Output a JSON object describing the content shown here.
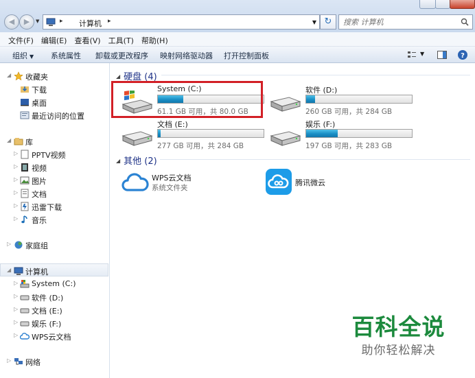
{
  "address": {
    "crumb": "计算机",
    "search_placeholder": "搜索 计算机"
  },
  "menu": [
    "文件(F)",
    "编辑(E)",
    "查看(V)",
    "工具(T)",
    "帮助(H)"
  ],
  "commands": {
    "organize": "组织",
    "properties": "系统属性",
    "uninstall": "卸载或更改程序",
    "map_drive": "映射网络驱动器",
    "control_panel": "打开控制面板"
  },
  "nav": {
    "favorites": "收藏夹",
    "downloads": "下载",
    "desktop": "桌面",
    "recent": "最近访问的位置",
    "libraries": "库",
    "pptv": "PPTV视频",
    "videos": "视频",
    "pictures": "图片",
    "documents": "文档",
    "thunder": "迅雷下载",
    "music": "音乐",
    "homegroup": "家庭组",
    "computer": "计算机",
    "drive_c": "System (C:)",
    "drive_d": "软件 (D:)",
    "drive_e": "文档 (E:)",
    "drive_f": "娱乐 (F:)",
    "wps": "WPS云文档",
    "network": "网络"
  },
  "groups": {
    "drives_header": "硬盘 (4)",
    "other_header": "其他 (2)"
  },
  "drives": [
    {
      "name": "System (C:)",
      "info": "61.1 GB 可用，共 80.0 GB",
      "used_fraction": 0.24
    },
    {
      "name": "软件 (D:)",
      "info": "260 GB 可用，共 284 GB",
      "used_fraction": 0.085
    },
    {
      "name": "文档 (E:)",
      "info": "277 GB 可用，共 284 GB",
      "used_fraction": 0.025
    },
    {
      "name": "娱乐 (F:)",
      "info": "197 GB 可用，共 283 GB",
      "used_fraction": 0.3
    }
  ],
  "others": [
    {
      "name": "WPS云文档",
      "sub": "系统文件夹"
    },
    {
      "name": "腾讯微云",
      "sub": ""
    }
  ],
  "watermark": {
    "title": "百科全说",
    "subtitle": "助你轻松解决"
  },
  "colors": {
    "accent_header": "#1e3287",
    "usage_bar": "#1a8fc6",
    "highlight_box": "#d21f26",
    "watermark_green": "#1c8a3d"
  }
}
